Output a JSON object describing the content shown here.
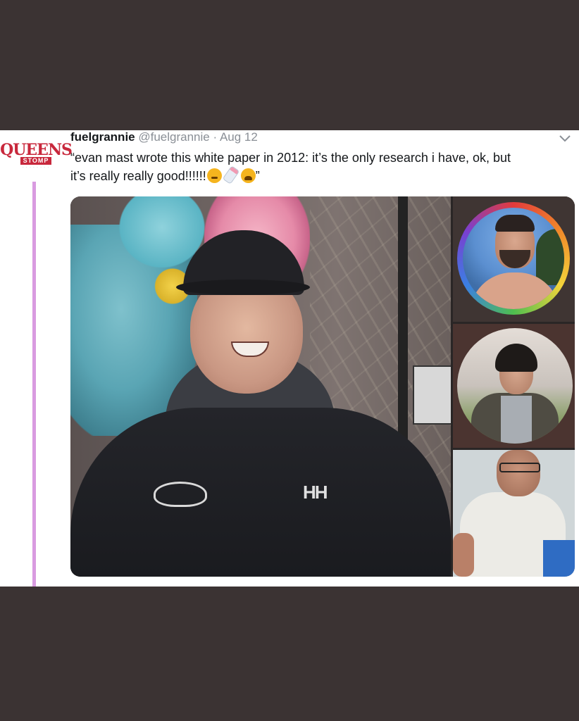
{
  "tweet": {
    "avatar_text": "QUEENS STOMP",
    "display_name": "fuelgrannie",
    "handle": "@fuelgrannie",
    "separator": "·",
    "date": "Aug 12",
    "text_line1": "“evan mast wrote this white paper in 2012: it’s the only research i have, ok, but",
    "text_line2_prefix": "it’s really really good!!!!!!",
    "text_line2_suffix": "”"
  },
  "colors": {
    "page_background": "#3b3333",
    "card_background": "#ffffff",
    "thread_line": "#d99be0",
    "brand_red": "#c8283c",
    "secondary_text": "#8a8f96"
  },
  "icons": [
    "chevron-down-icon",
    "angry-face-emoji",
    "baby-bottle-emoji",
    "tired-face-emoji"
  ]
}
